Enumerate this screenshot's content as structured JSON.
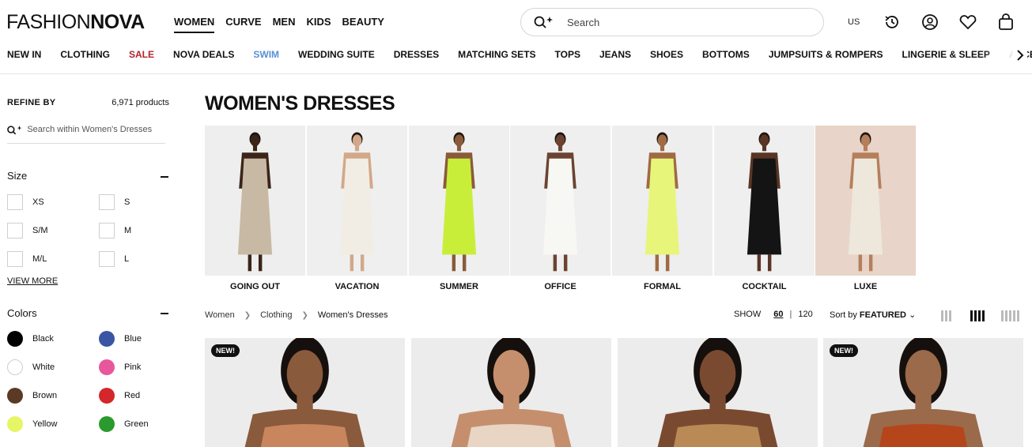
{
  "header": {
    "logo_light": "FASHION",
    "logo_bold": "NOVA",
    "nav": [
      "WOMEN",
      "CURVE",
      "MEN",
      "KIDS",
      "BEAUTY"
    ],
    "search_placeholder": "Search",
    "locale": "US"
  },
  "catnav": {
    "items": [
      "NEW IN",
      "CLOTHING",
      "SALE",
      "NOVA DEALS",
      "SWIM",
      "WEDDING SUITE",
      "DRESSES",
      "MATCHING SETS",
      "TOPS",
      "JEANS",
      "SHOES",
      "BOTTOMS",
      "JUMPSUITS & ROMPERS",
      "LINGERIE & SLEEP",
      "ACCESS"
    ]
  },
  "sidebar": {
    "refine_label": "REFINE BY",
    "product_count": "6,971 products",
    "search_placeholder": "Search within Women's Dresses",
    "size_title": "Size",
    "sizes": [
      "XS",
      "S",
      "S/M",
      "M",
      "M/L",
      "L"
    ],
    "view_more": "VIEW MORE",
    "colors_title": "Colors",
    "colors": [
      {
        "label": "Black",
        "hex": "#000000"
      },
      {
        "label": "Blue",
        "hex": "#3a55a4"
      },
      {
        "label": "White",
        "hex": "#ffffff"
      },
      {
        "label": "Pink",
        "hex": "#e8579c"
      },
      {
        "label": "Brown",
        "hex": "#5a3a24"
      },
      {
        "label": "Red",
        "hex": "#d4262b"
      },
      {
        "label": "Yellow",
        "hex": "#e6f566"
      },
      {
        "label": "Green",
        "hex": "#2a9a2e"
      }
    ]
  },
  "main": {
    "title": "WOMEN'S DRESSES",
    "categories": [
      {
        "label": "GOING OUT",
        "bg": "#eeeeee",
        "skin": "#3b2418",
        "dress": "#c8b9a4"
      },
      {
        "label": "VACATION",
        "bg": "#efefef",
        "skin": "#d2a888",
        "dress": "#f1ede4"
      },
      {
        "label": "SUMMER",
        "bg": "#efefef",
        "skin": "#8a5a3a",
        "dress": "#c9ee3a"
      },
      {
        "label": "OFFICE",
        "bg": "#efefef",
        "skin": "#6b4330",
        "dress": "#f7f7f3"
      },
      {
        "label": "FORMAL",
        "bg": "#eeeeee",
        "skin": "#a06a44",
        "dress": "#e7f57a"
      },
      {
        "label": "COCKTAIL",
        "bg": "#efefef",
        "skin": "#5a3524",
        "dress": "#141414"
      },
      {
        "label": "LUXE",
        "bg": "#e8d4c8",
        "skin": "#b57f5c",
        "dress": "#eee8dc"
      }
    ],
    "breadcrumb": [
      "Women",
      "Clothing",
      "Women's Dresses"
    ],
    "show_label": "SHOW",
    "show_options": [
      "60",
      "120"
    ],
    "sort_prefix": "Sort by",
    "sort_value": "FEATURED",
    "products": [
      {
        "badge": "NEW!",
        "skin": "#8a5a3c",
        "dress": "#c9865e"
      },
      {
        "badge": "",
        "skin": "#c58f6e",
        "dress": "#e8d5c4"
      },
      {
        "badge": "",
        "skin": "#7a4a30",
        "dress": "#b98a55"
      },
      {
        "badge": "NEW!",
        "skin": "#9a6a4a",
        "dress": "#b5451b"
      }
    ]
  }
}
